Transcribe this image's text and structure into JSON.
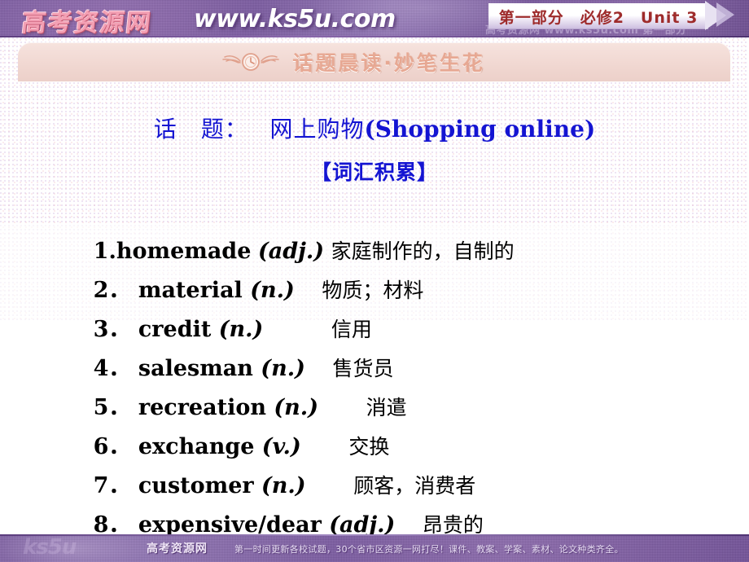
{
  "topbar": {
    "logo_cn": "高考资源网",
    "logo_url": "www.ks5u.com",
    "ghost_text": "高考资源网 www.ks5u.com 第一部分",
    "ribbon_label": "第一部分　必修2　Unit 3",
    "accent_purple": "#7d5da3",
    "ribbon_text_color": "#9e2b2b",
    "logo_pink": "#f3a0b4"
  },
  "section_header": {
    "title": "话题晨读·妙笔生花",
    "icon": "winged-clock-icon",
    "bg_color": "#f1d8d2",
    "text_color": "#e7a893"
  },
  "main": {
    "topic_label": "话　题：",
    "topic_cn": "网上购物",
    "topic_en": "(Shopping online)",
    "vocab_heading": "【词汇积累】",
    "heading_color": "#1414d2",
    "vocab": [
      {
        "num": "1.",
        "word": "homemade",
        "pos": "(adj.)",
        "gloss": "家庭制作的，自制的"
      },
      {
        "num": "2．",
        "word": " material ",
        "pos": "(n.)",
        "gloss": "　物质；材料"
      },
      {
        "num": "3．",
        "word": " credit ",
        "pos": "(n.)",
        "gloss": "　　　信用"
      },
      {
        "num": "4．",
        "word": " salesman ",
        "pos": "(n.)",
        "gloss": "　售货员"
      },
      {
        "num": "5．",
        "word": " recreation ",
        "pos": "(n.)",
        "gloss": "　　消遣"
      },
      {
        "num": "6．",
        "word": " exchange ",
        "pos": "(v.)",
        "gloss": "　　交换"
      },
      {
        "num": "7．",
        "word": " customer ",
        "pos": "(n.)",
        "gloss": "　　顾客，消费者"
      },
      {
        "num": "8．",
        "word": " expensive/dear ",
        "pos": "(adj.)",
        "gloss": "　昂贵的"
      }
    ]
  },
  "footer": {
    "brand": "高考资源网",
    "tagline": "第一时间更新各校试题，30个省市区资源一网打尽！课件、教案、学案、素材、论文种类齐全。",
    "watermark": "ks5u",
    "bg_color": "#7d5da3"
  }
}
